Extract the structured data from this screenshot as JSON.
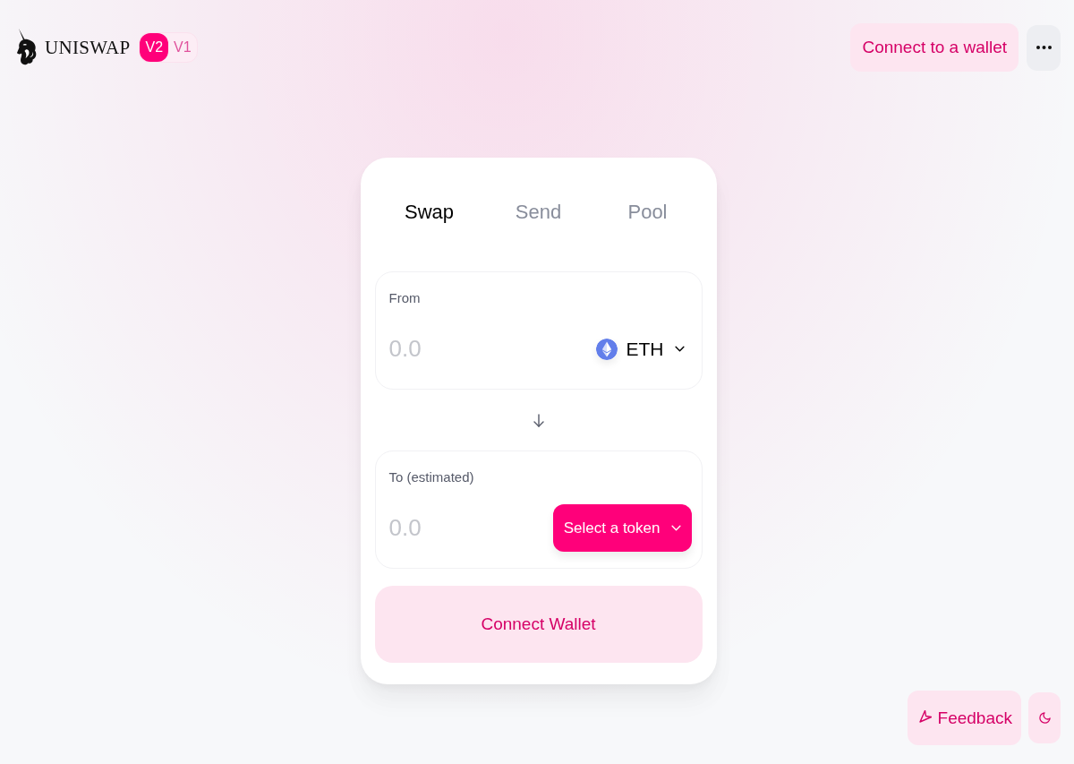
{
  "header": {
    "wordmark": "UNISWAP",
    "versions": [
      {
        "label": "V2",
        "selected": true
      },
      {
        "label": "V1",
        "selected": false
      }
    ],
    "connect_button": "Connect to a wallet"
  },
  "swap_card": {
    "tabs": [
      {
        "label": "Swap",
        "selected": true
      },
      {
        "label": "Send",
        "selected": false
      },
      {
        "label": "Pool",
        "selected": false
      }
    ],
    "panels": [
      {
        "label": "From",
        "placeholder": "0.0",
        "token": {
          "kind": "token",
          "text": "ETH"
        }
      },
      {
        "label": "To (estimated)",
        "placeholder": "0.0",
        "token": {
          "kind": "select",
          "text": "Select a token"
        }
      }
    ],
    "action_button": "Connect Wallet"
  },
  "footer": {
    "feedback_button": "Feedback"
  }
}
